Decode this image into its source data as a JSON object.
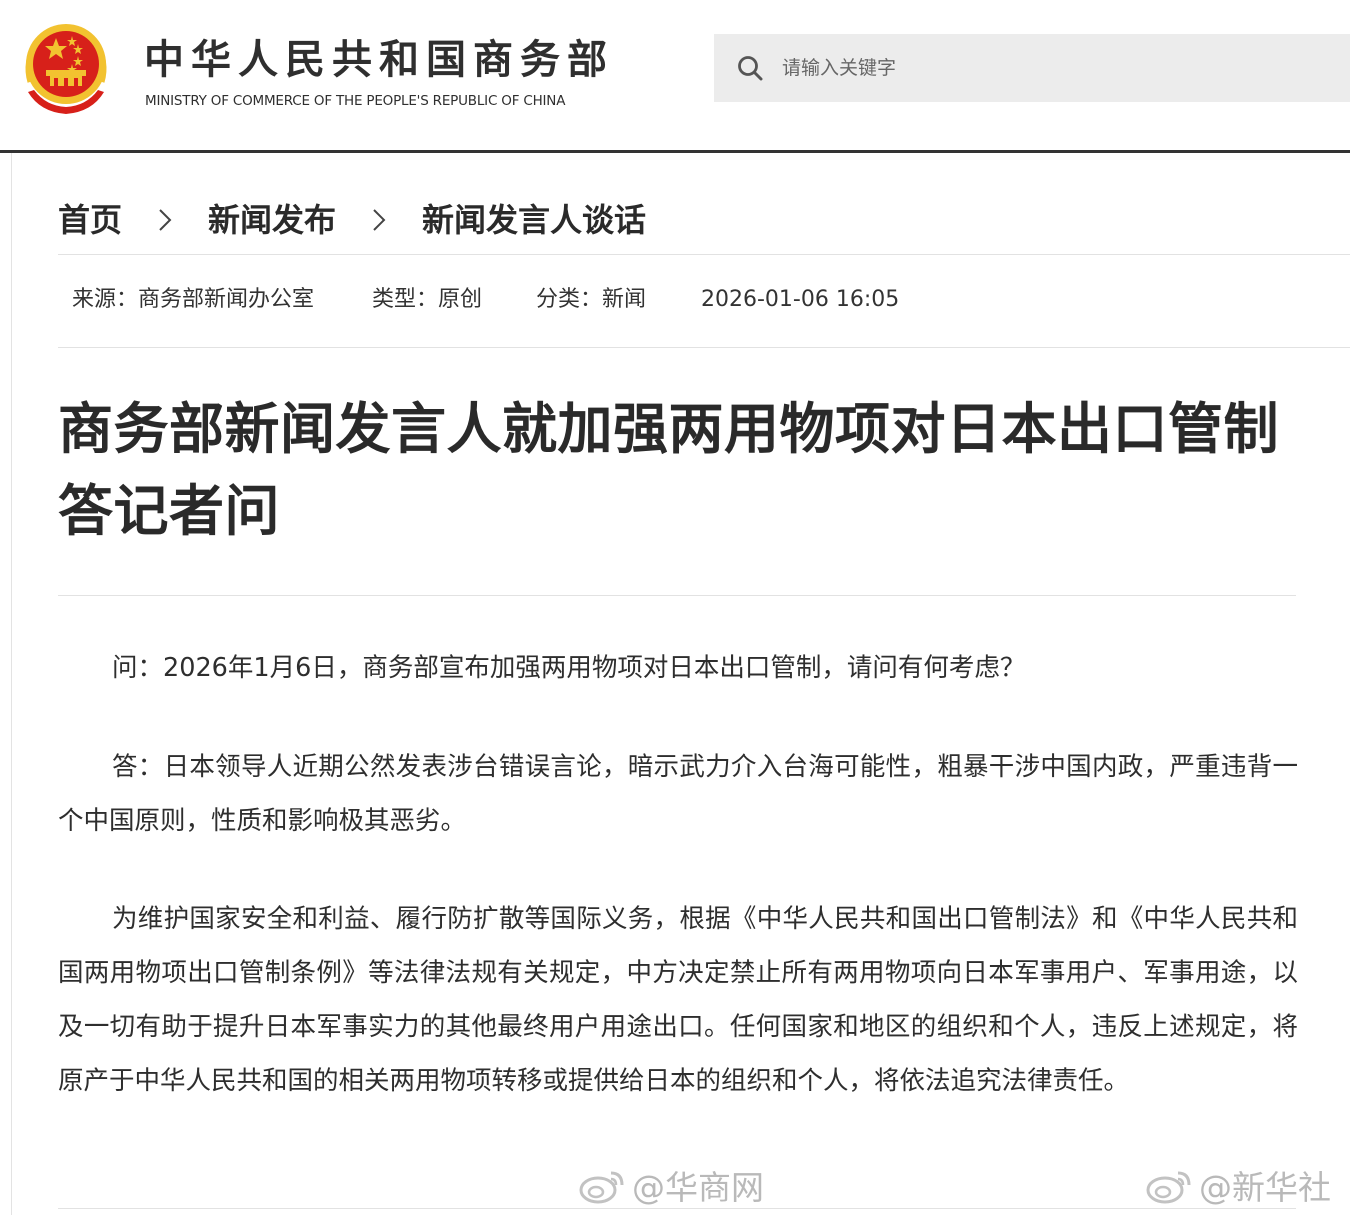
{
  "header": {
    "title_cn": "中华人民共和国商务部",
    "title_en": "MINISTRY OF COMMERCE OF THE PEOPLE'S REPUBLIC OF CHINA",
    "search_placeholder": "请输入关键字",
    "emblem_icon": "national-emblem-icon",
    "search_icon": "search-icon"
  },
  "breadcrumb": {
    "items": [
      "首页",
      "新闻发布",
      "新闻发言人谈话"
    ],
    "separator_icon": "chevron-right-icon"
  },
  "meta": {
    "source": "来源：商务部新闻办公室",
    "type": "类型：原创",
    "category": "分类：新闻",
    "datetime": "2026-01-06 16:05"
  },
  "article": {
    "title": "商务部新闻发言人就加强两用物项对日本出口管制答记者问",
    "paragraphs": [
      "问：2026年1月6日，商务部宣布加强两用物项对日本出口管制，请问有何考虑？",
      "答：日本领导人近期公然发表涉台错误言论，暗示武力介入台海可能性，粗暴干涉中国内政，严重违背一个中国原则，性质和影响极其恶劣。",
      "为维护国家安全和利益、履行防扩散等国际义务，根据《中华人民共和国出口管制法》和《中华人民共和国两用物项出口管制条例》等法律法规有关规定，中方决定禁止所有两用物项向日本军事用户、军事用途，以及一切有助于提升日本军事实力的其他最终用户用途出口。任何国家和地区的组织和个人，违反上述规定，将原产于中华人民共和国的相关两用物项转移或提供给日本的组织和个人，将依法追究法律责任。"
    ]
  },
  "watermarks": [
    "@华商网",
    "@新华社"
  ],
  "colors": {
    "emblem_red": "#d7201a",
    "emblem_gold": "#f2c230",
    "text_dark": "#2a2a2a",
    "search_bg": "#ececec",
    "watermark": "#b9b9b9"
  }
}
